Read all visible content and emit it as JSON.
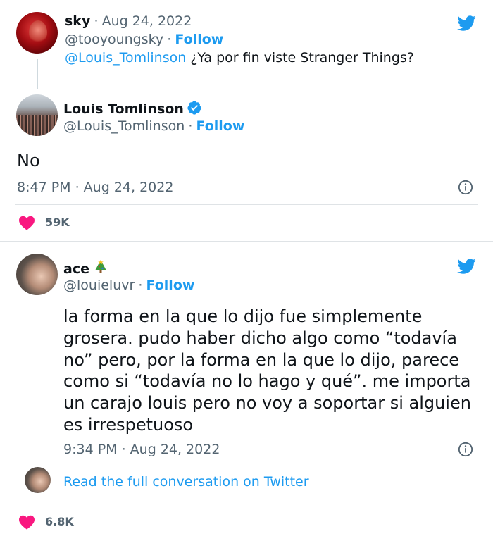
{
  "tweet1": {
    "name": "sky",
    "sep": "·",
    "date": "Aug 24, 2022",
    "handle": "@tooyoungsky",
    "follow": "Follow",
    "mention": "@Louis_Tomlinson",
    "text": " ¿Ya por fin viste Stranger Things?"
  },
  "tweet2": {
    "name": "Louis Tomlinson",
    "handle": "@Louis_Tomlinson",
    "sep": "·",
    "follow": "Follow",
    "text": "No",
    "time": "8:47 PM · Aug 24, 2022",
    "likes": "59K"
  },
  "tweet3": {
    "name": "ace",
    "handle": "@louieluvr",
    "sep": "·",
    "follow": "Follow",
    "lines": [
      "la forma en la que lo dijo fue simplemente",
      "grosera. pudo haber dicho algo como “todavía",
      "no” pero, por la forma en la que lo dijo, parece",
      "como si “todavía no lo hago y qué”. me importa",
      "un carajo louis pero no voy a soportar si alguien",
      "es irrespetuoso"
    ],
    "time": "9:34 PM · Aug 24, 2022",
    "read_more": "Read the full conversation on Twitter",
    "likes": "6.8K"
  },
  "colors": {
    "twitter_blue": "#1d9bf0",
    "heart": "#f91880",
    "muted": "#536471",
    "divider": "#dfe3e6"
  },
  "icons": [
    "twitter-bird-icon",
    "verified-badge-icon",
    "info-icon",
    "heart-icon",
    "christmas-tree-emoji"
  ]
}
